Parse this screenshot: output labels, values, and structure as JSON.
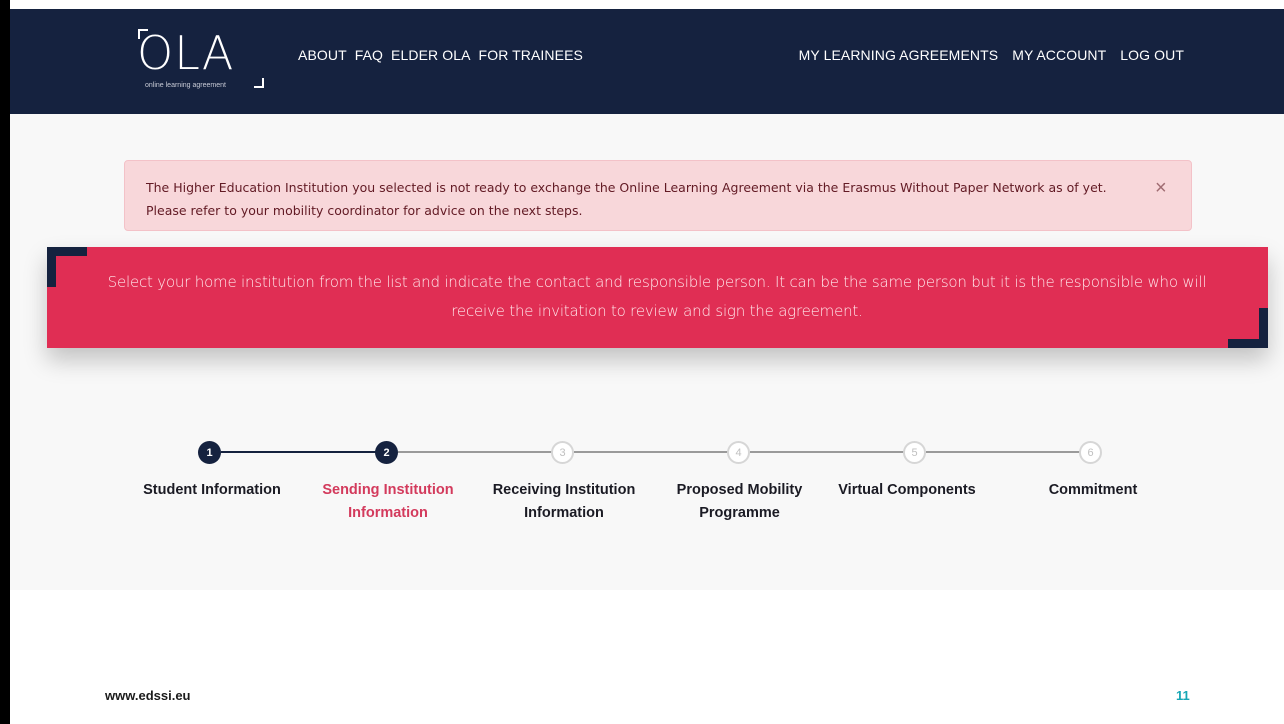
{
  "logo": {
    "text": "OLA",
    "subtitle": "online learning agreement"
  },
  "nav": {
    "left": [
      "ABOUT",
      "FAQ",
      "ELDER OLA",
      "FOR TRAINEES"
    ],
    "right": [
      "MY LEARNING AGREEMENTS",
      "MY ACCOUNT",
      "LOG OUT"
    ]
  },
  "alert": {
    "text": "The Higher Education Institution you selected is not ready to exchange the Online Learning Agreement via the Erasmus Without Paper Network as of yet. Please refer to your mobility coordinator for advice on the next steps.",
    "close_symbol": "×"
  },
  "banner": {
    "text": "Select your home institution from the list and indicate the contact and responsible person. It can be the same person but it is the responsible who will receive the invitation to review and sign the agreement."
  },
  "steps": [
    {
      "number": "1",
      "label": "Student Information",
      "state": "done"
    },
    {
      "number": "2",
      "label": "Sending Institution Information",
      "state": "current"
    },
    {
      "number": "3",
      "label": "Receiving Institution Information",
      "state": "todo"
    },
    {
      "number": "4",
      "label": "Proposed Mobility Programme",
      "state": "todo"
    },
    {
      "number": "5",
      "label": "Virtual Components",
      "state": "todo"
    },
    {
      "number": "6",
      "label": "Commitment",
      "state": "todo"
    }
  ],
  "footer": {
    "url": "www.edssi.eu",
    "page_number": "11"
  },
  "colors": {
    "navy": "#15223f",
    "accent_pink": "#e02e54",
    "alert_bg": "#f8d7da",
    "page_number": "#17a7b5"
  }
}
